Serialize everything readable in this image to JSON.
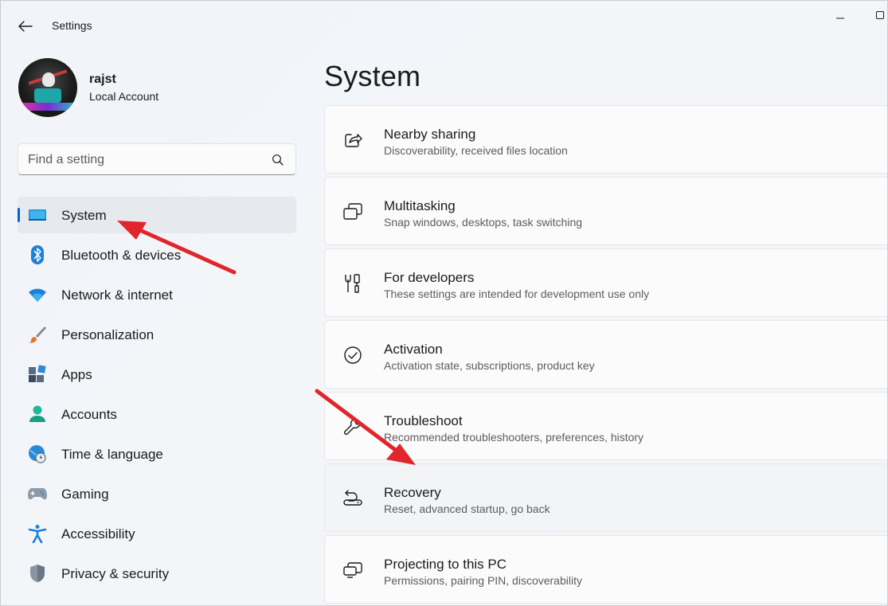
{
  "window": {
    "title": "Settings",
    "back_icon": "back-arrow-icon",
    "minimize_icon": "minimize-icon",
    "maximize_icon": "maximize-icon"
  },
  "profile": {
    "name": "rajst",
    "account_type": "Local Account"
  },
  "search": {
    "placeholder": "Find a setting",
    "value": "",
    "icon": "search-icon"
  },
  "sidebar": {
    "items": [
      {
        "label": "System",
        "icon": "system-display-icon",
        "selected": true
      },
      {
        "label": "Bluetooth & devices",
        "icon": "bluetooth-icon"
      },
      {
        "label": "Network & internet",
        "icon": "wifi-icon"
      },
      {
        "label": "Personalization",
        "icon": "paintbrush-icon"
      },
      {
        "label": "Apps",
        "icon": "apps-icon"
      },
      {
        "label": "Accounts",
        "icon": "person-icon"
      },
      {
        "label": "Time & language",
        "icon": "globe-clock-icon"
      },
      {
        "label": "Gaming",
        "icon": "gamepad-icon"
      },
      {
        "label": "Accessibility",
        "icon": "accessibility-icon"
      },
      {
        "label": "Privacy & security",
        "icon": "shield-icon"
      }
    ]
  },
  "main": {
    "title": "System",
    "cards": [
      {
        "title": "Nearby sharing",
        "description": "Discoverability, received files location",
        "icon": "share-icon"
      },
      {
        "title": "Multitasking",
        "description": "Snap windows, desktops, task switching",
        "icon": "multitasking-icon"
      },
      {
        "title": "For developers",
        "description": "These settings are intended for development use only",
        "icon": "developer-tools-icon"
      },
      {
        "title": "Activation",
        "description": "Activation state, subscriptions, product key",
        "icon": "checkmark-circle-icon"
      },
      {
        "title": "Troubleshoot",
        "description": "Recommended troubleshooters, preferences, history",
        "icon": "wrench-icon"
      },
      {
        "title": "Recovery",
        "description": "Reset, advanced startup, go back",
        "icon": "recovery-icon",
        "highlighted": true
      },
      {
        "title": "Projecting to this PC",
        "description": "Permissions, pairing PIN, discoverability",
        "icon": "projecting-icon"
      }
    ]
  },
  "colors": {
    "accent": "#0067c0",
    "annotation_arrow": "#e0262b"
  }
}
